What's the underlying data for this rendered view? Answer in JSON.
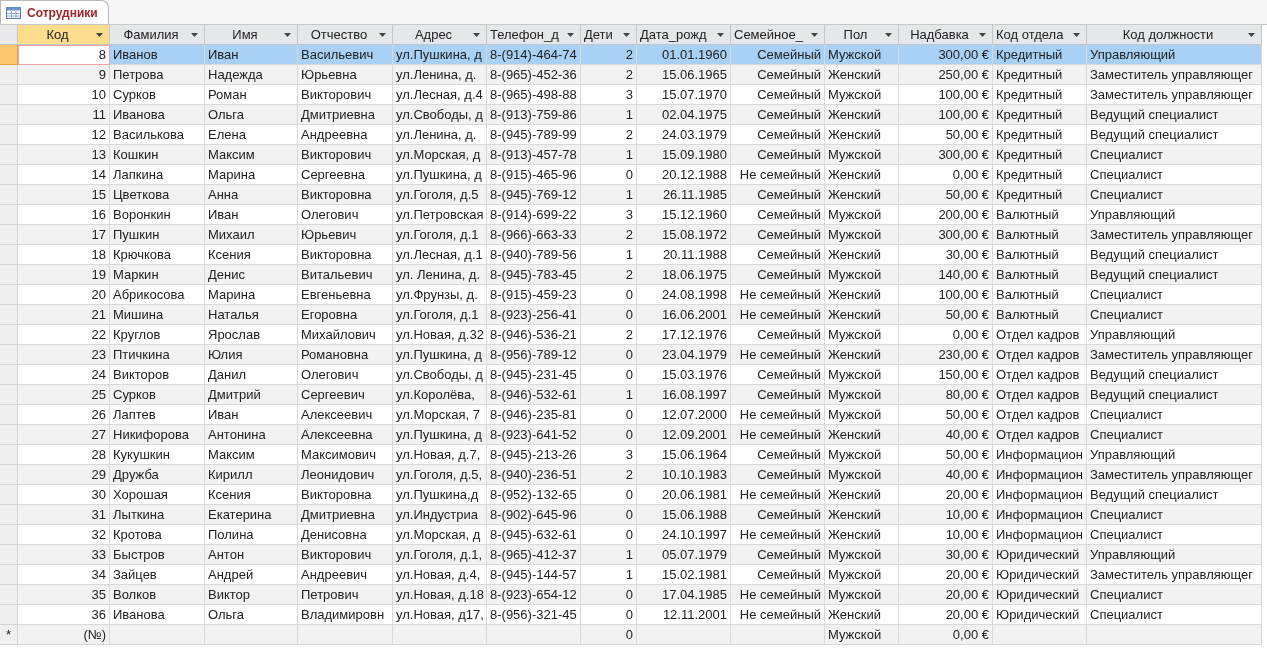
{
  "tab": {
    "label": "Сотрудники",
    "selected": true
  },
  "columns": [
    {
      "label": "Код",
      "selected": true
    },
    {
      "label": "Фамилия",
      "selected": false
    },
    {
      "label": "Имя",
      "selected": false
    },
    {
      "label": "Отчество",
      "selected": false
    },
    {
      "label": "Адрес",
      "selected": false
    },
    {
      "label": "Телефон_д",
      "selected": false
    },
    {
      "label": "Дети",
      "selected": false
    },
    {
      "label": "Дата_рожд",
      "selected": false
    },
    {
      "label": "Семейное_",
      "selected": false
    },
    {
      "label": "Пол",
      "selected": false
    },
    {
      "label": "Надбавка",
      "selected": false
    },
    {
      "label": "Код отдела",
      "selected": false
    },
    {
      "label": "Код должности",
      "selected": false
    }
  ],
  "rows": [
    {
      "selected": true,
      "cells": [
        "8",
        "Иванов",
        "Иван",
        "Васильевич",
        "ул.Пушкина, д",
        "8-(914)-464-74",
        "2",
        "01.01.1960",
        "Семейный",
        "Мужской",
        "300,00 €",
        "Кредитный",
        "Управляющий"
      ]
    },
    {
      "selected": false,
      "cells": [
        "9",
        "Петрова",
        "Надежда",
        "Юрьевна",
        "ул.Ленина, д.",
        "8-(965)-452-36",
        "2",
        "15.06.1965",
        "Семейный",
        "Женский",
        "250,00 €",
        "Кредитный",
        "Заместитель управляющег"
      ]
    },
    {
      "selected": false,
      "cells": [
        "10",
        "Сурков",
        "Роман",
        "Викторович",
        "ул.Лесная, д.4",
        "8-(965)-498-88",
        "3",
        "15.07.1970",
        "Семейный",
        "Мужской",
        "100,00 €",
        "Кредитный",
        "Заместитель управляющег"
      ]
    },
    {
      "selected": false,
      "cells": [
        "11",
        "Иванова",
        "Ольга",
        "Дмитриевна",
        "ул.Свободы, д",
        "8-(913)-759-86",
        "1",
        "02.04.1975",
        "Семейный",
        "Женский",
        "100,00 €",
        "Кредитный",
        "Ведущий специалист"
      ]
    },
    {
      "selected": false,
      "cells": [
        "12",
        "Василькова",
        "Елена",
        "Андреевна",
        "ул.Ленина, д.",
        "8-(945)-789-99",
        "2",
        "24.03.1979",
        "Семейный",
        "Женский",
        "50,00 €",
        "Кредитный",
        "Ведущий специалист"
      ]
    },
    {
      "selected": false,
      "cells": [
        "13",
        "Кошкин",
        "Максим",
        "Викторович",
        "ул.Морская, д",
        "8-(913)-457-78",
        "1",
        "15.09.1980",
        "Семейный",
        "Мужской",
        "300,00 €",
        "Кредитный",
        "Специалист"
      ]
    },
    {
      "selected": false,
      "cells": [
        "14",
        "Лапкина",
        "Марина",
        "Сергеевна",
        "ул.Пушкина, д",
        "8-(915)-465-96",
        "0",
        "20.12.1988",
        "Не семейный",
        "Женский",
        "0,00 €",
        "Кредитный",
        "Специалист"
      ]
    },
    {
      "selected": false,
      "cells": [
        "15",
        "Цветкова",
        "Анна",
        "Викторовна",
        "ул.Гоголя, д.5",
        "8-(945)-769-12",
        "1",
        "26.11.1985",
        "Семейный",
        "Женский",
        "50,00 €",
        "Кредитный",
        "Специалист"
      ]
    },
    {
      "selected": false,
      "cells": [
        "16",
        "Воронкин",
        "Иван",
        "Олегович",
        "ул.Петровская",
        "8-(914)-699-22",
        "3",
        "15.12.1960",
        "Семейный",
        "Мужской",
        "200,00 €",
        "Валютный",
        "Управляющий"
      ]
    },
    {
      "selected": false,
      "cells": [
        "17",
        "Пушкин",
        "Михаил",
        "Юрьевич",
        "ул.Гоголя, д.1",
        "8-(966)-663-33",
        "2",
        "15.08.1972",
        "Семейный",
        "Мужской",
        "300,00 €",
        "Валютный",
        "Заместитель управляющег"
      ]
    },
    {
      "selected": false,
      "cells": [
        "18",
        "Крючкова",
        "Ксения",
        "Викторовна",
        "ул.Лесная, д.1",
        "8-(940)-789-56",
        "1",
        "20.11.1988",
        "Семейный",
        "Женский",
        "30,00 €",
        "Валютный",
        "Ведущий специалист"
      ]
    },
    {
      "selected": false,
      "cells": [
        "19",
        "Маркин",
        "Денис",
        "Витальевич",
        "ул. Ленина, д.",
        "8-(945)-783-45",
        "2",
        "18.06.1975",
        "Семейный",
        "Мужской",
        "140,00 €",
        "Валютный",
        "Ведущий специалист"
      ]
    },
    {
      "selected": false,
      "cells": [
        "20",
        "Абрикосова",
        "Марина",
        "Евгеньевна",
        "ул.Фрунзы, д.",
        "8-(915)-459-23",
        "0",
        "24.08.1998",
        "Не семейный",
        "Женский",
        "100,00 €",
        "Валютный",
        "Специалист"
      ]
    },
    {
      "selected": false,
      "cells": [
        "21",
        "Мишина",
        "Наталья",
        "Егоровна",
        "ул.Гоголя, д.1",
        "8-(923)-256-41",
        "0",
        "16.06.2001",
        "Не семейный",
        "Женский",
        "50,00 €",
        "Валютный",
        "Специалист"
      ]
    },
    {
      "selected": false,
      "cells": [
        "22",
        "Круглов",
        "Ярослав",
        "Михайлович",
        "ул.Новая, д.32",
        "8-(946)-536-21",
        "2",
        "17.12.1976",
        "Семейный",
        "Мужской",
        "0,00 €",
        "Отдел кадров",
        "Управляющий"
      ]
    },
    {
      "selected": false,
      "cells": [
        "23",
        "Птичкина",
        "Юлия",
        "Романовна",
        "ул.Пушкина, д",
        "8-(956)-789-12",
        "0",
        "23.04.1979",
        "Не семейный",
        "Женский",
        "230,00 €",
        "Отдел кадров",
        "Заместитель управляющег"
      ]
    },
    {
      "selected": false,
      "cells": [
        "24",
        "Викторов",
        "Данил",
        "Олегович",
        "ул.Свободы, д",
        "8-(945)-231-45",
        "0",
        "15.03.1976",
        "Семейный",
        "Мужской",
        "150,00 €",
        "Отдел кадров",
        "Ведущий специалист"
      ]
    },
    {
      "selected": false,
      "cells": [
        "25",
        "Сурков",
        "Дмитрий",
        "Сергеевич",
        "ул.Королёва,",
        "8-(946)-532-61",
        "1",
        "16.08.1997",
        "Семейный",
        "Мужской",
        "80,00 €",
        "Отдел кадров",
        "Ведущий специалист"
      ]
    },
    {
      "selected": false,
      "cells": [
        "26",
        "Лаптев",
        "Иван",
        "Алексеевич",
        "ул.Морская, 7",
        "8-(946)-235-81",
        "0",
        "12.07.2000",
        "Не семейный",
        "Мужской",
        "50,00 €",
        "Отдел кадров",
        "Специалист"
      ]
    },
    {
      "selected": false,
      "cells": [
        "27",
        "Никифорова",
        "Антонина",
        "Алексеевна",
        "ул.Пушкина, д",
        "8-(923)-641-52",
        "0",
        "12.09.2001",
        "Не семейный",
        "Женский",
        "40,00 €",
        "Отдел кадров",
        "Специалист"
      ]
    },
    {
      "selected": false,
      "cells": [
        "28",
        "Кукушкин",
        "Максим",
        "Максимович",
        "ул.Новая, д.7,",
        "8-(945)-213-26",
        "3",
        "15.06.1964",
        "Семейный",
        "Мужской",
        "50,00 €",
        "Информацион",
        "Управляющий"
      ]
    },
    {
      "selected": false,
      "cells": [
        "29",
        "Дружба",
        "Кирилл",
        "Леонидович",
        "ул.Гоголя, д.5,",
        "8-(940)-236-51",
        "2",
        "10.10.1983",
        "Семейный",
        "Мужской",
        "40,00 €",
        "Информацион",
        "Заместитель управляющег"
      ]
    },
    {
      "selected": false,
      "cells": [
        "30",
        "Хорошая",
        "Ксения",
        "Викторовна",
        "ул.Пушкина,д",
        "8-(952)-132-65",
        "0",
        "20.06.1981",
        "Не семейный",
        "Женский",
        "20,00 €",
        "Информацион",
        "Ведущий специалист"
      ]
    },
    {
      "selected": false,
      "cells": [
        "31",
        "Лыткина",
        "Екатерина",
        "Дмитриевна",
        "ул.Индустриа",
        "8-(902)-645-96",
        "0",
        "15.06.1988",
        "Семейный",
        "Женский",
        "10,00 €",
        "Информацион",
        "Специалист"
      ]
    },
    {
      "selected": false,
      "cells": [
        "32",
        "Кротова",
        "Полина",
        "Денисовна",
        "ул.Морская, д",
        "8-(945)-632-61",
        "0",
        "24.10.1997",
        "Не семейный",
        "Женский",
        "10,00 €",
        "Информацион",
        "Специалист"
      ]
    },
    {
      "selected": false,
      "cells": [
        "33",
        "Быстров",
        "Антон",
        "Викторович",
        "ул.Гоголя, д.1,",
        "8-(965)-412-37",
        "1",
        "05.07.1979",
        "Семейный",
        "Мужской",
        "30,00 €",
        "Юридический",
        "Управляющий"
      ]
    },
    {
      "selected": false,
      "cells": [
        "34",
        "Зайцев",
        "Андрей",
        "Андреевич",
        "ул.Новая, д.4,",
        "8-(945)-144-57",
        "1",
        "15.02.1981",
        "Семейный",
        "Мужской",
        "20,00 €",
        "Юридический",
        "Заместитель управляющег"
      ]
    },
    {
      "selected": false,
      "cells": [
        "35",
        "Волков",
        "Виктор",
        "Петрович",
        "ул.Новая, д.18",
        "8-(923)-654-12",
        "0",
        "17.04.1985",
        "Не семейный",
        "Мужской",
        "20,00 €",
        "Юридический",
        "Специалист"
      ]
    },
    {
      "selected": false,
      "cells": [
        "36",
        "Иванова",
        "Ольга",
        "Владимировн",
        "ул.Новая, д17,",
        "8-(956)-321-45",
        "0",
        "12.11.2001",
        "Не семейный",
        "Женский",
        "20,00 €",
        "Юридический",
        "Специалист"
      ]
    }
  ],
  "new_row": {
    "marker": "*",
    "code": "(№)",
    "children": "0",
    "gender": "Мужской",
    "bonus": "0,00 €"
  }
}
